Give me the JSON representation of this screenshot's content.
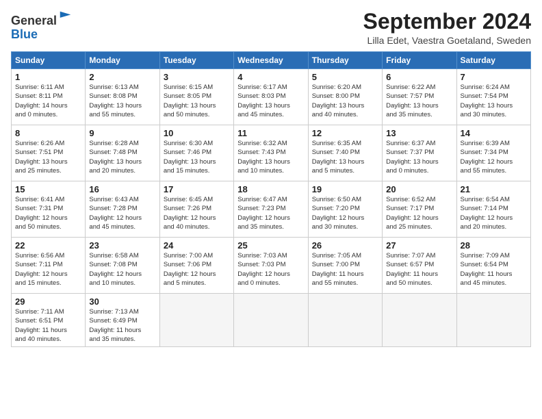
{
  "header": {
    "logo_general": "General",
    "logo_blue": "Blue",
    "month_title": "September 2024",
    "location": "Lilla Edet, Vaestra Goetaland, Sweden"
  },
  "weekdays": [
    "Sunday",
    "Monday",
    "Tuesday",
    "Wednesday",
    "Thursday",
    "Friday",
    "Saturday"
  ],
  "weeks": [
    [
      {
        "day": "1",
        "info": "Sunrise: 6:11 AM\nSunset: 8:11 PM\nDaylight: 14 hours\nand 0 minutes."
      },
      {
        "day": "2",
        "info": "Sunrise: 6:13 AM\nSunset: 8:08 PM\nDaylight: 13 hours\nand 55 minutes."
      },
      {
        "day": "3",
        "info": "Sunrise: 6:15 AM\nSunset: 8:05 PM\nDaylight: 13 hours\nand 50 minutes."
      },
      {
        "day": "4",
        "info": "Sunrise: 6:17 AM\nSunset: 8:03 PM\nDaylight: 13 hours\nand 45 minutes."
      },
      {
        "day": "5",
        "info": "Sunrise: 6:20 AM\nSunset: 8:00 PM\nDaylight: 13 hours\nand 40 minutes."
      },
      {
        "day": "6",
        "info": "Sunrise: 6:22 AM\nSunset: 7:57 PM\nDaylight: 13 hours\nand 35 minutes."
      },
      {
        "day": "7",
        "info": "Sunrise: 6:24 AM\nSunset: 7:54 PM\nDaylight: 13 hours\nand 30 minutes."
      }
    ],
    [
      {
        "day": "8",
        "info": "Sunrise: 6:26 AM\nSunset: 7:51 PM\nDaylight: 13 hours\nand 25 minutes."
      },
      {
        "day": "9",
        "info": "Sunrise: 6:28 AM\nSunset: 7:48 PM\nDaylight: 13 hours\nand 20 minutes."
      },
      {
        "day": "10",
        "info": "Sunrise: 6:30 AM\nSunset: 7:46 PM\nDaylight: 13 hours\nand 15 minutes."
      },
      {
        "day": "11",
        "info": "Sunrise: 6:32 AM\nSunset: 7:43 PM\nDaylight: 13 hours\nand 10 minutes."
      },
      {
        "day": "12",
        "info": "Sunrise: 6:35 AM\nSunset: 7:40 PM\nDaylight: 13 hours\nand 5 minutes."
      },
      {
        "day": "13",
        "info": "Sunrise: 6:37 AM\nSunset: 7:37 PM\nDaylight: 13 hours\nand 0 minutes."
      },
      {
        "day": "14",
        "info": "Sunrise: 6:39 AM\nSunset: 7:34 PM\nDaylight: 12 hours\nand 55 minutes."
      }
    ],
    [
      {
        "day": "15",
        "info": "Sunrise: 6:41 AM\nSunset: 7:31 PM\nDaylight: 12 hours\nand 50 minutes."
      },
      {
        "day": "16",
        "info": "Sunrise: 6:43 AM\nSunset: 7:28 PM\nDaylight: 12 hours\nand 45 minutes."
      },
      {
        "day": "17",
        "info": "Sunrise: 6:45 AM\nSunset: 7:26 PM\nDaylight: 12 hours\nand 40 minutes."
      },
      {
        "day": "18",
        "info": "Sunrise: 6:47 AM\nSunset: 7:23 PM\nDaylight: 12 hours\nand 35 minutes."
      },
      {
        "day": "19",
        "info": "Sunrise: 6:50 AM\nSunset: 7:20 PM\nDaylight: 12 hours\nand 30 minutes."
      },
      {
        "day": "20",
        "info": "Sunrise: 6:52 AM\nSunset: 7:17 PM\nDaylight: 12 hours\nand 25 minutes."
      },
      {
        "day": "21",
        "info": "Sunrise: 6:54 AM\nSunset: 7:14 PM\nDaylight: 12 hours\nand 20 minutes."
      }
    ],
    [
      {
        "day": "22",
        "info": "Sunrise: 6:56 AM\nSunset: 7:11 PM\nDaylight: 12 hours\nand 15 minutes."
      },
      {
        "day": "23",
        "info": "Sunrise: 6:58 AM\nSunset: 7:08 PM\nDaylight: 12 hours\nand 10 minutes."
      },
      {
        "day": "24",
        "info": "Sunrise: 7:00 AM\nSunset: 7:06 PM\nDaylight: 12 hours\nand 5 minutes."
      },
      {
        "day": "25",
        "info": "Sunrise: 7:03 AM\nSunset: 7:03 PM\nDaylight: 12 hours\nand 0 minutes."
      },
      {
        "day": "26",
        "info": "Sunrise: 7:05 AM\nSunset: 7:00 PM\nDaylight: 11 hours\nand 55 minutes."
      },
      {
        "day": "27",
        "info": "Sunrise: 7:07 AM\nSunset: 6:57 PM\nDaylight: 11 hours\nand 50 minutes."
      },
      {
        "day": "28",
        "info": "Sunrise: 7:09 AM\nSunset: 6:54 PM\nDaylight: 11 hours\nand 45 minutes."
      }
    ],
    [
      {
        "day": "29",
        "info": "Sunrise: 7:11 AM\nSunset: 6:51 PM\nDaylight: 11 hours\nand 40 minutes."
      },
      {
        "day": "30",
        "info": "Sunrise: 7:13 AM\nSunset: 6:49 PM\nDaylight: 11 hours\nand 35 minutes."
      },
      {
        "day": "",
        "info": ""
      },
      {
        "day": "",
        "info": ""
      },
      {
        "day": "",
        "info": ""
      },
      {
        "day": "",
        "info": ""
      },
      {
        "day": "",
        "info": ""
      }
    ]
  ]
}
